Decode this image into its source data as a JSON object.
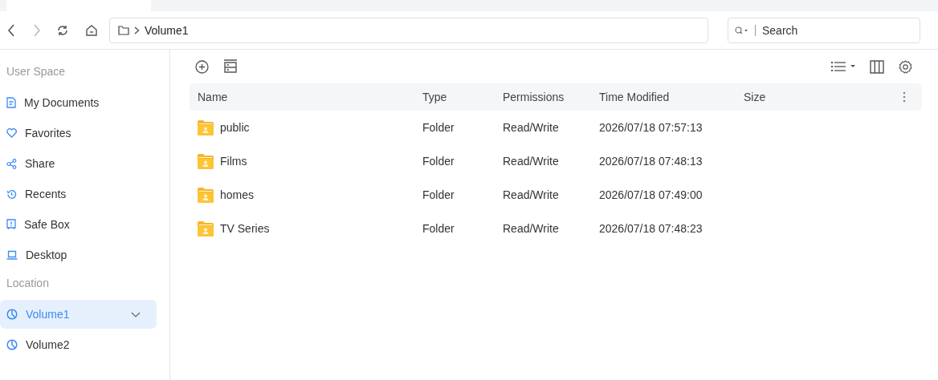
{
  "breadcrumb": {
    "path": [
      "Volume1"
    ]
  },
  "search": {
    "placeholder": "Search"
  },
  "sidebar": {
    "sections": [
      {
        "title": "User Space",
        "items": [
          {
            "label": "My Documents",
            "kind": "document",
            "selected": false,
            "expandable": false
          },
          {
            "label": "Favorites",
            "kind": "heart",
            "selected": false,
            "expandable": false
          },
          {
            "label": "Share",
            "kind": "share",
            "selected": false,
            "expandable": false
          },
          {
            "label": "Recents",
            "kind": "history",
            "selected": false,
            "expandable": false
          },
          {
            "label": "Safe Box",
            "kind": "safe",
            "selected": false,
            "expandable": false
          },
          {
            "label": "Desktop",
            "kind": "laptop",
            "selected": false,
            "expandable": false
          }
        ]
      },
      {
        "title": "Location",
        "items": [
          {
            "label": "Volume1",
            "kind": "volume",
            "selected": true,
            "expandable": true
          },
          {
            "label": "Volume2",
            "kind": "volume",
            "selected": false,
            "expandable": false
          }
        ]
      }
    ]
  },
  "table": {
    "columns": [
      "Name",
      "Type",
      "Permissions",
      "Time Modified",
      "Size"
    ],
    "rows": [
      {
        "name": "public",
        "type": "Folder",
        "permissions": "Read/Write",
        "modified": "2026/07/18 07:57:13",
        "size": ""
      },
      {
        "name": "Films",
        "type": "Folder",
        "permissions": "Read/Write",
        "modified": "2026/07/18 07:48:13",
        "size": ""
      },
      {
        "name": "homes",
        "type": "Folder",
        "permissions": "Read/Write",
        "modified": "2026/07/18 07:49:00",
        "size": ""
      },
      {
        "name": "TV Series",
        "type": "Folder",
        "permissions": "Read/Write",
        "modified": "2026/07/18 07:48:23",
        "size": ""
      }
    ]
  }
}
